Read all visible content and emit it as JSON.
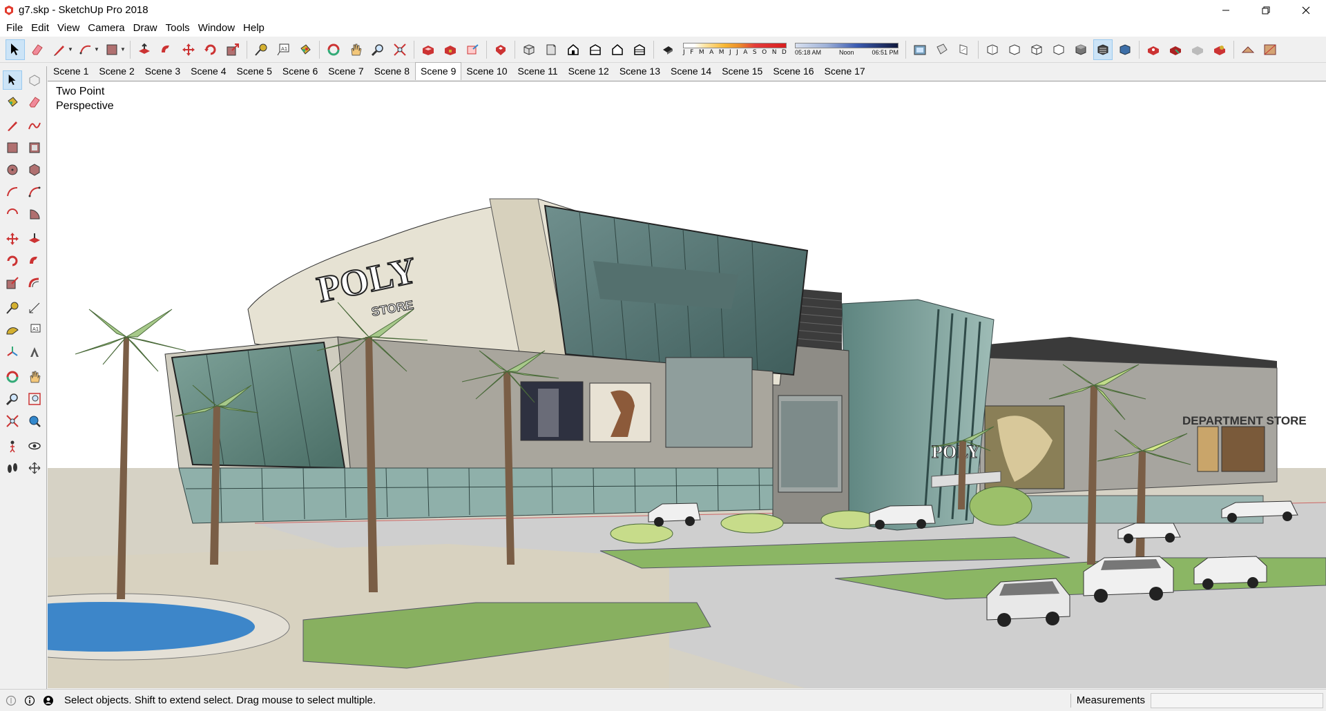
{
  "window": {
    "title": "g7.skp - SketchUp Pro 2018",
    "controls": [
      "minimize-icon",
      "restore-icon",
      "close-icon"
    ]
  },
  "menu": [
    "File",
    "Edit",
    "View",
    "Camera",
    "Draw",
    "Tools",
    "Window",
    "Help"
  ],
  "shadow_settings": {
    "months": [
      "J",
      "F",
      "M",
      "A",
      "M",
      "J",
      "J",
      "A",
      "S",
      "O",
      "N",
      "D"
    ],
    "time_start": "05:18 AM",
    "time_mid": "Noon",
    "time_end": "06:51 PM"
  },
  "toolbar_top_icons": [
    "select-icon",
    "eraser-icon",
    "pencil-line-icon",
    "arc-icon",
    "rectangle-icon",
    "push-pull-icon",
    "follow-me-icon",
    "move-icon",
    "rotate-icon",
    "scale-icon",
    "tape-measure-icon",
    "text-icon",
    "paint-bucket-icon",
    "orbit-icon",
    "pan-icon",
    "zoom-icon",
    "zoom-extents-icon",
    "warehouse-get-models-icon",
    "warehouse-share-model-icon",
    "share-component-icon",
    "extension-warehouse-icon",
    "iso-view-icon",
    "top-view-icon",
    "front-view-icon",
    "right-view-icon",
    "back-view-icon",
    "left-view-icon",
    "shadows-toggle-icon",
    "section-plane-icon",
    "display-section-icon",
    "display-section-cuts-icon",
    "xray-style-icon",
    "back-edges-icon",
    "wireframe-icon",
    "hidden-line-icon",
    "shaded-icon",
    "shaded-textures-icon",
    "monochrome-icon",
    "layout-icon",
    "style-builder-icon",
    "profile-icon",
    "solid-tools-icon",
    "sandbox-icon",
    "photo-match-icon"
  ],
  "scenes": {
    "active": "Scene 9",
    "tabs": [
      "Scene 1",
      "Scene 2",
      "Scene 3",
      "Scene 4",
      "Scene 5",
      "Scene 6",
      "Scene 7",
      "Scene 8",
      "Scene 9",
      "Scene 10",
      "Scene 11",
      "Scene 12",
      "Scene 13",
      "Scene 14",
      "Scene 15",
      "Scene 16",
      "Scene 17"
    ]
  },
  "left_toolbar_icons": [
    "select-icon",
    "make-component-icon",
    "paint-bucket-icon",
    "eraser-icon",
    "line-icon",
    "freehand-icon",
    "rectangle-icon",
    "rotated-rectangle-icon",
    "circle-icon",
    "polygon-icon",
    "arc-icon",
    "two-point-arc-icon",
    "three-point-arc-icon",
    "pie-icon",
    "move-icon",
    "push-pull-icon",
    "rotate-icon",
    "follow-me-icon",
    "scale-icon",
    "offset-icon",
    "tape-measure-icon",
    "dimension-icon",
    "protractor-icon",
    "text-icon",
    "axes-icon",
    "3d-text-icon",
    "orbit-icon",
    "pan-icon",
    "zoom-icon",
    "zoom-window-icon",
    "zoom-extents-icon",
    "previous-view-icon",
    "position-camera-icon",
    "look-around-icon",
    "walk-icon",
    "section-plane-icon"
  ],
  "viewport": {
    "camera_label_line1": "Two Point",
    "camera_label_line2": "Perspective",
    "building_sign": "POLY",
    "building_sign_sub": "STORE",
    "tower_sign": "POLY",
    "dept_store_sign": "DEPARTMENT STORE"
  },
  "status": {
    "message": "Select objects. Shift to extend select. Drag mouse to select multiple.",
    "measurements_label": "Measurements",
    "measurements_value": ""
  }
}
